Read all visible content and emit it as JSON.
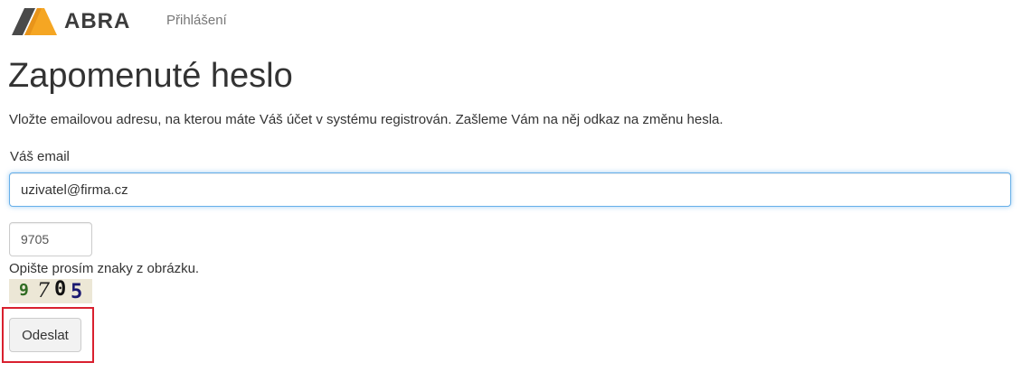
{
  "navbar": {
    "brand_name": "ABRA",
    "brand_icon": "abra-logo-icon",
    "login_link": "Přihlášení"
  },
  "main": {
    "title": "Zapomenuté heslo",
    "description": "Vložte emailovou adresu, na kterou máte Váš účet v systému registrován. Zašleme Vám na něj odkaz na změnu hesla.",
    "email": {
      "label": "Váš email",
      "value": "uzivatel@firma.cz"
    },
    "captcha": {
      "value": "9705",
      "hint": "Opište prosím znaky z obrázku.",
      "image_chars": [
        "9",
        "7",
        "0",
        "5"
      ]
    },
    "submit_label": "Odeslat"
  },
  "colors": {
    "focus_border": "#66afe9",
    "highlight_border": "#d9202f",
    "logo_dark": "#4a4a4a",
    "logo_accent": "#f5a623"
  }
}
